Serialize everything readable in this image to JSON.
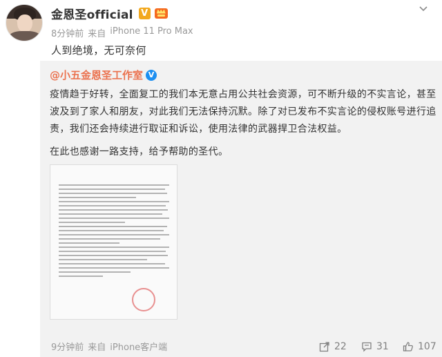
{
  "post": {
    "author": "金恩圣official",
    "verified_mark": "V",
    "time": "8分钟前",
    "via_label": "来自",
    "device": "iPhone 11 Pro Max",
    "text": "人到绝境，无可奈何"
  },
  "repost": {
    "author": "@小五金恩圣工作室",
    "verified_mark": "V",
    "body": "疫情趋于好转，全面复工的我们本无意占用公共社会资源，可不断升级的不实言论，甚至波及到了家人和朋友，对此我们无法保持沉默。除了对已发布不实言论的侵权账号进行追责，我们还会持续进行取证和诉讼，使用法律的武器捍卫合法权益。",
    "thanks": "在此也感谢一路支持，给予帮助的圣代。",
    "time": "9分钟前",
    "via_label": "来自",
    "device": "iPhone客户端",
    "actions": {
      "repost_count": "22",
      "comment_count": "31",
      "like_count": "107"
    }
  },
  "colors": {
    "repost_author": "#eb7350",
    "verified_orange": "#f2a81d",
    "verified_blue": "#1d8ff1",
    "repost_bg": "#f2f2f2"
  },
  "icons": [
    "chevron-down-icon",
    "share-icon",
    "comment-icon",
    "like-icon"
  ]
}
